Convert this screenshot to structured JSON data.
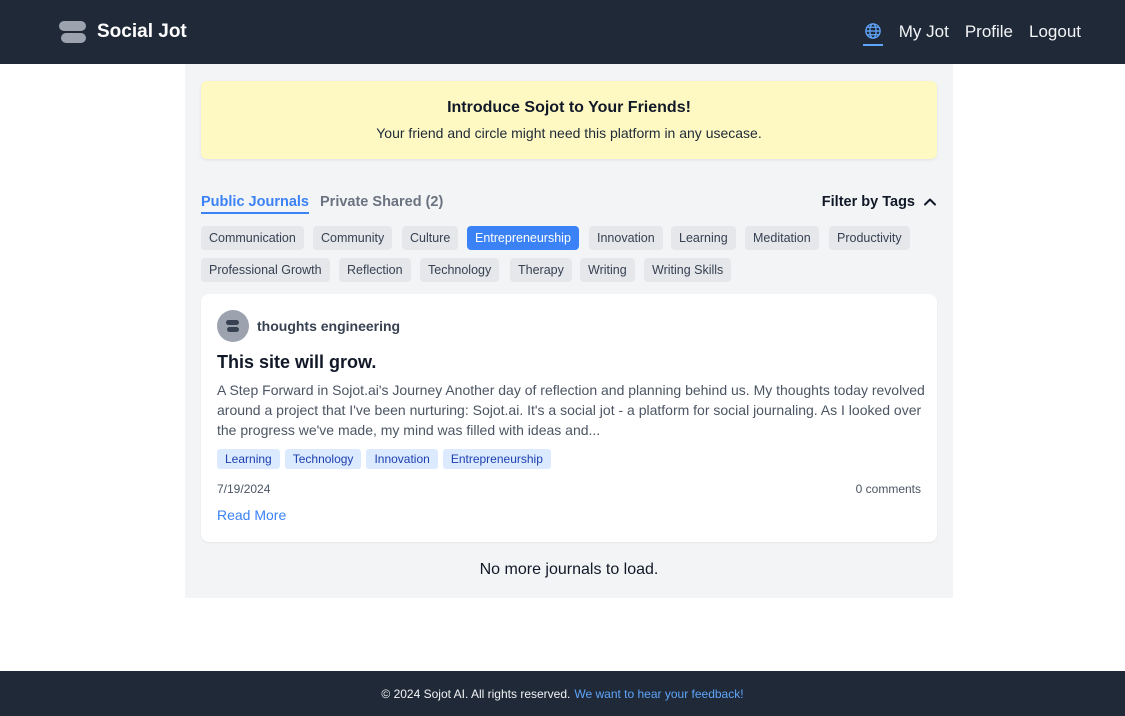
{
  "nav": {
    "brand": "Social Jot",
    "links": {
      "my_jot": "My Jot",
      "profile": "Profile",
      "logout": "Logout"
    },
    "language_icon": "globe-icon"
  },
  "promo": {
    "title": "Introduce Sojot to Your Friends!",
    "text": "Your friend and circle might need this platform in any usecase."
  },
  "tabs": {
    "public": "Public Journals",
    "private": "Private Shared (2)",
    "filter": "Filter by Tags",
    "filter_icon": "chevron-up-icon"
  },
  "tags": [
    "Communication",
    "Community",
    "Culture",
    "Entrepreneurship",
    "Innovation",
    "Learning",
    "Meditation",
    "Productivity",
    "Professional Growth",
    "Reflection",
    "Technology",
    "Therapy",
    "Writing",
    "Writing Skills"
  ],
  "active_tag": "Entrepreneurship",
  "post": {
    "author": "thoughts engineering",
    "title": "This site will grow.",
    "excerpt": "A Step Forward in Sojot.ai's Journey Another day of reflection and planning behind us. My thoughts today revolved around a project that I've been nurturing: Sojot.ai. It's a social jot - a platform for social journaling. As I looked over the progress we've made, my mind was filled with ideas and...",
    "tags": [
      "Learning",
      "Technology",
      "Innovation",
      "Entrepreneurship"
    ],
    "date": "7/19/2024",
    "comments": "0 comments",
    "read_more": "Read More"
  },
  "end_text": "No more journals to load.",
  "footer": {
    "copyright": "© 2024 Sojot AI. All rights reserved.",
    "feedback": "We want to hear your feedback!"
  },
  "colors": {
    "nav_bg": "#1f2937",
    "accent": "#3b82f6",
    "promo_bg": "#fef9c3",
    "tag_bg": "#e5e7eb",
    "post_tag_bg": "#dbeafe"
  }
}
